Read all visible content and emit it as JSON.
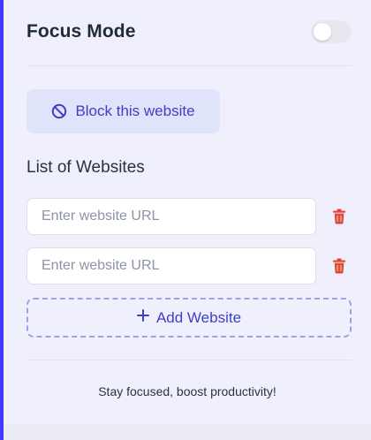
{
  "header": {
    "title": "Focus Mode",
    "toggle_on": false
  },
  "block_button": {
    "label": "Block this website",
    "icon": "block-icon"
  },
  "websites": {
    "section_title": "List of Websites",
    "items": [
      {
        "value": "",
        "placeholder": "Enter website URL"
      },
      {
        "value": "",
        "placeholder": "Enter website URL"
      }
    ],
    "add_label": "Add Website"
  },
  "footer": {
    "text": "Stay focused, boost productivity!"
  },
  "colors": {
    "accent": "#4338ff",
    "button_text": "#3f3fc4",
    "delete": "#e04a3c"
  }
}
